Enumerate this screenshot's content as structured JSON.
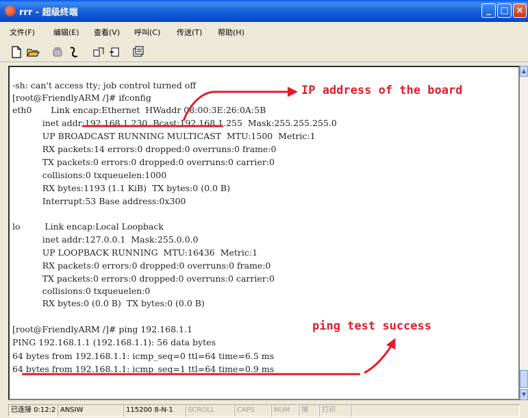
{
  "window": {
    "title": "rrr - 超级终端"
  },
  "menu": [
    {
      "label": "文件(F)"
    },
    {
      "label": "编辑(E)"
    },
    {
      "label": "查看(V)"
    },
    {
      "label": "呼叫(C)"
    },
    {
      "label": "传送(T)"
    },
    {
      "label": "帮助(H)"
    }
  ],
  "toolbar_icons": [
    "new-file-icon",
    "open-folder-icon",
    "phone-icon",
    "disconnect-icon",
    "send-icon",
    "receive-icon",
    "properties-icon"
  ],
  "terminal": {
    "lines": [
      "-sh: can't access tty; job control turned off",
      "[root@FriendlyARM /]# ifconfig",
      "eth0       Link encap:Ethernet  HWaddr 08:00:3E:26:0A:5B",
      "           inet addr:192.168.1.230  Bcast:192.168.1.255  Mask:255.255.255.0",
      "           UP BROADCAST RUNNING MULTICAST  MTU:1500  Metric:1",
      "           RX packets:14 errors:0 dropped:0 overruns:0 frame:0",
      "           TX packets:0 errors:0 dropped:0 overruns:0 carrier:0",
      "           collisions:0 txqueuelen:1000",
      "           RX bytes:1193 (1.1 KiB)  TX bytes:0 (0.0 B)",
      "           Interrupt:53 Base address:0x300",
      "",
      "lo         Link encap:Local Loopback",
      "           inet addr:127.0.0.1  Mask:255.0.0.0",
      "           UP LOOPBACK RUNNING  MTU:16436  Metric:1",
      "           RX packets:0 errors:0 dropped:0 overruns:0 frame:0",
      "           TX packets:0 errors:0 dropped:0 overruns:0 carrier:0",
      "           collisions:0 txqueuelen:0",
      "           RX bytes:0 (0.0 B)  TX bytes:0 (0.0 B)",
      "",
      "[root@FriendlyARM /]# ping 192.168.1.1",
      "PING 192.168.1.1 (192.168.1.1): 56 data bytes",
      "64 bytes from 192.168.1.1: icmp_seq=0 ttl=64 time=6.5 ms",
      "64 bytes from 192.168.1.1: icmp_seq=1 ttl=64 time=0.9 ms"
    ]
  },
  "annotations": {
    "ip_label": "IP address of the board",
    "ping_label": "ping test success",
    "color": "#e01e2a"
  },
  "status": {
    "connected": "已连接 0:12:2",
    "terminal_type": "ANSIW",
    "settings": "115200 8-N-1",
    "scroll": "SCROLL",
    "caps": "CAPS",
    "num": "NUM",
    "capture": "捕",
    "print": "打印"
  }
}
